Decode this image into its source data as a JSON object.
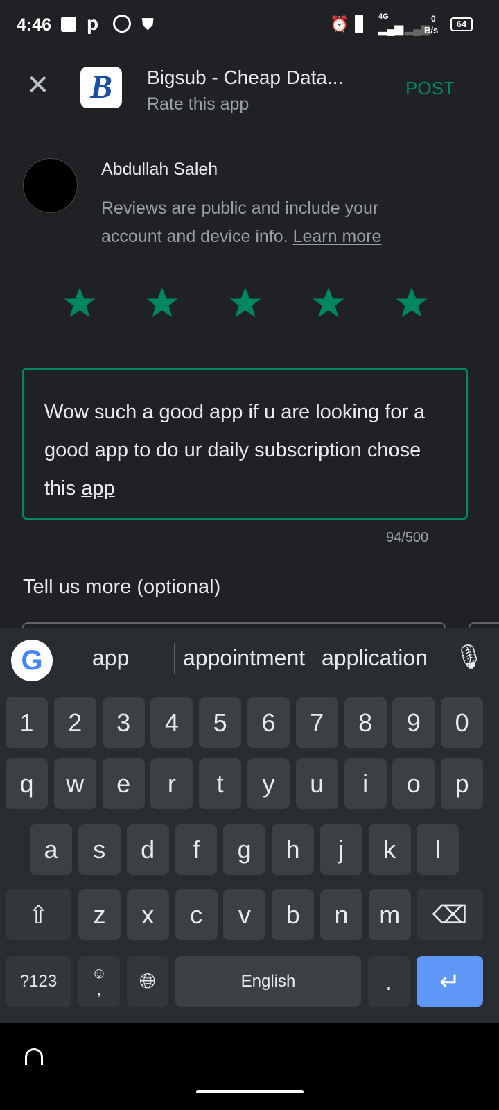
{
  "status_bar": {
    "time": "4:46",
    "network": "4G",
    "speed_value": "0",
    "speed_unit": "B/s",
    "battery": "64"
  },
  "header": {
    "app_title": "Bigsub - Cheap Data...",
    "subtitle": "Rate this app",
    "post_label": "POST"
  },
  "user": {
    "name": "Abdullah Saleh",
    "notice": "Reviews are public and include your account and device info.",
    "learn_more": "Learn more"
  },
  "rating": {
    "value": 5,
    "max": 5,
    "color": "#01875f"
  },
  "review": {
    "text_before": "Wow such a good app if u are looking for a good app to do ur daily subscription chose this ",
    "text_underlined": "app",
    "counter": "94/500"
  },
  "tell_more": {
    "label": "Tell us more (optional)"
  },
  "keyboard": {
    "suggestions": [
      "app",
      "appointment",
      "application"
    ],
    "rows": [
      [
        "1",
        "2",
        "3",
        "4",
        "5",
        "6",
        "7",
        "8",
        "9",
        "0"
      ],
      [
        "q",
        "w",
        "e",
        "r",
        "t",
        "y",
        "u",
        "i",
        "o",
        "p"
      ],
      [
        "a",
        "s",
        "d",
        "f",
        "g",
        "h",
        "j",
        "k",
        "l"
      ],
      [
        "z",
        "x",
        "c",
        "v",
        "b",
        "n",
        "m"
      ]
    ],
    "symbols_label": "?123",
    "comma": ",",
    "space_label": "English",
    "period": "."
  }
}
